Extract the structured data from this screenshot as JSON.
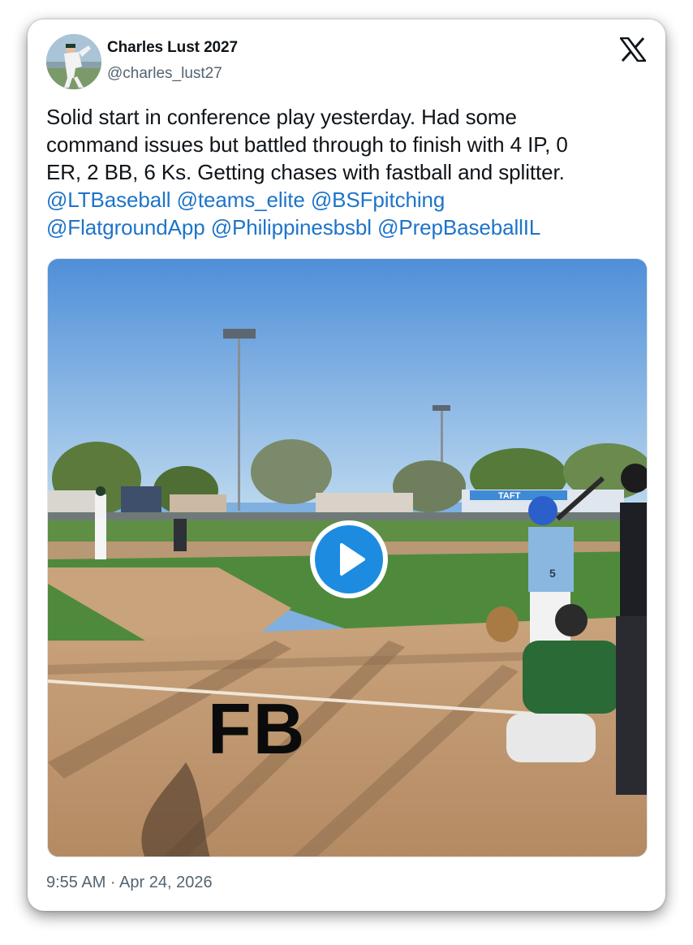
{
  "user": {
    "display_name": "Charles Lust 2027",
    "handle": "@charles_lust27"
  },
  "brand_icon": "x-logo-icon",
  "tweet": {
    "lines": [
      "Solid start in conference play yesterday. Had some",
      "command issues but battled through to finish with 4 IP, 0",
      "ER, 2 BB, 6 Ks. Getting chases with fastball and splitter."
    ],
    "mentions": [
      "@LTBaseball",
      "@teams_elite",
      "@BSFpitching",
      "@FlatgroundApp",
      "@Philippinesbsbl",
      "@PrepBaseballIL"
    ]
  },
  "media": {
    "type": "video",
    "overlay_label": "FB",
    "scoreboard_text": "TAFT",
    "jersey_number": "5",
    "play_icon": "play-icon"
  },
  "timestamp": "9:55 AM · Apr 24, 2026",
  "colors": {
    "link": "#1d74c9",
    "play_button": "#1d8ce0",
    "text_primary": "#0f1419",
    "text_secondary": "#536471"
  }
}
